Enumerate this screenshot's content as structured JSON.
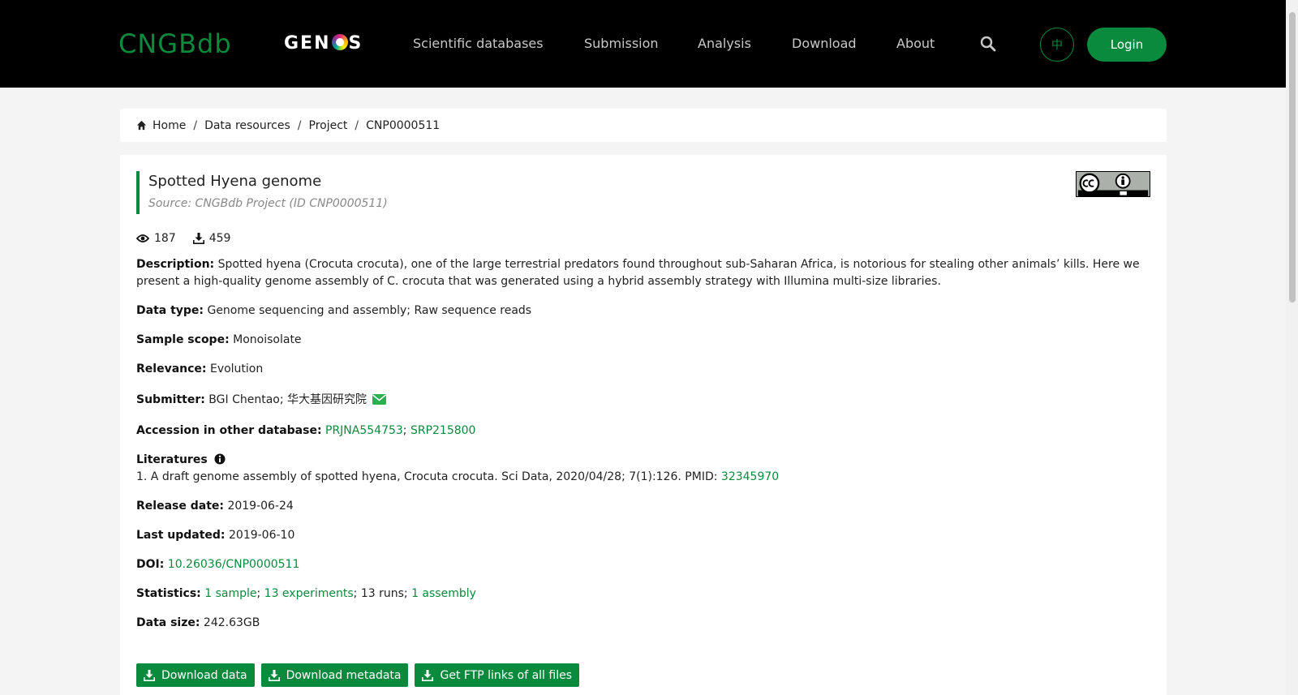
{
  "header": {
    "logo_cngb": "CNGBdb",
    "logo_genos_left": "GEN",
    "logo_genos_right": "S",
    "nav": [
      "Scientific databases",
      "Submission",
      "Analysis",
      "Download",
      "About"
    ],
    "lang_label": "中",
    "login_label": "Login"
  },
  "breadcrumb": [
    "Home",
    "Data resources",
    "Project",
    "CNP0000511"
  ],
  "project": {
    "title": "Spotted Hyena genome",
    "source": "Source: CNGBdb Project (ID CNP0000511)",
    "views": "187",
    "downloads": "459"
  },
  "fields": {
    "description_label": "Description:",
    "description_line1": "Spotted hyena (Crocuta crocuta), one of the large terrestrial predators found throughout sub-Saharan Africa, is notorious for stealing other animals’ kills. Here we",
    "description_line2": "present a high-quality genome assembly of C. crocuta that was generated using a hybrid assembly strategy with Illumina multi-size libraries.",
    "data_type_label": "Data type:",
    "data_type": "Genome sequencing and assembly; Raw sequence reads",
    "sample_scope_label": "Sample scope:",
    "sample_scope": "Monoisolate",
    "relevance_label": "Relevance:",
    "relevance": "Evolution",
    "submitter_label": "Submitter:",
    "submitter": "BGI Chentao; 华大基因研究院",
    "accession_label": "Accession in other database:",
    "accession_1": "PRJNA554753",
    "accession_2": "SRP215800",
    "literatures_label": "Literatures",
    "literature_1_text": "1. A draft genome assembly of spotted hyena, Crocuta crocuta. Sci Data, 2020/04/28; 7(1):126. PMID:",
    "literature_1_pmid": "32345970",
    "release_label": "Release date:",
    "release": "2019-06-24",
    "updated_label": "Last updated:",
    "updated": "2019-06-10",
    "doi_label": "DOI:",
    "doi": "10.26036/CNP0000511",
    "statistics_label": "Statistics:",
    "stat_samples": "1 sample",
    "stat_experiments": "13 experiments",
    "stat_runs": "13 runs",
    "stat_assembly": "1 assembly",
    "data_size_label": "Data size:",
    "data_size": "242.63GB"
  },
  "buttons": {
    "download_data": "Download data",
    "download_metadata": "Download metadata",
    "ftp_links": "Get FTP links of all files"
  },
  "colors": {
    "brand": "#0a8a3c",
    "navbar": "#000000"
  },
  "icons": [
    "home-icon",
    "eye-icon",
    "download-icon",
    "envelope-icon",
    "info-icon",
    "search-icon",
    "cc-by-icon"
  ]
}
